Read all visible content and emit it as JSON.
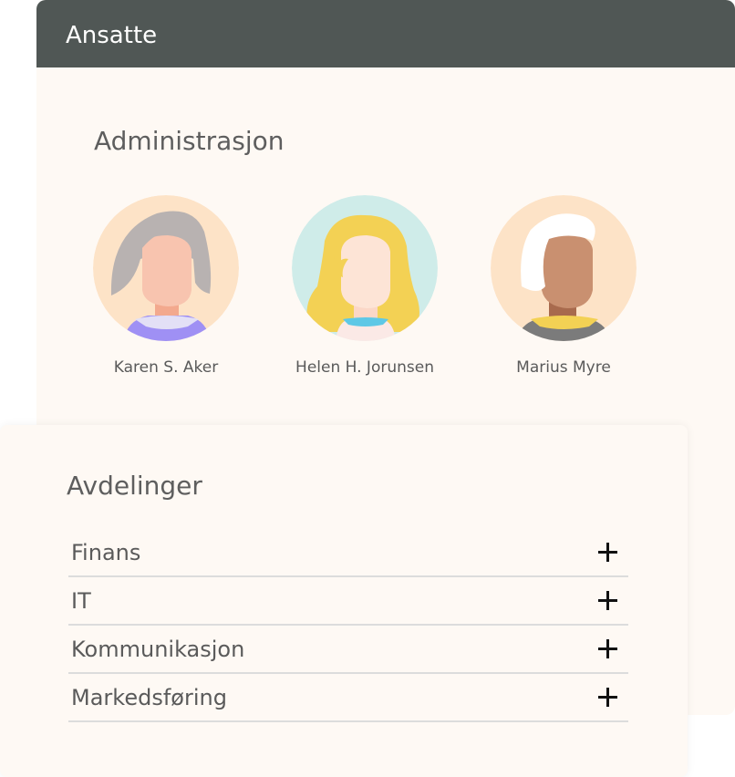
{
  "header": {
    "title": "Ansatte"
  },
  "admin": {
    "title": "Administrasjon",
    "people": [
      {
        "name": "Karen S. Aker",
        "avatar": "avatar-grey-hair"
      },
      {
        "name": "Helen H. Jorunsen",
        "avatar": "avatar-blonde-hair"
      },
      {
        "name": "Marius Myre",
        "avatar": "avatar-white-hair"
      }
    ]
  },
  "departments": {
    "title": "Avdelinger",
    "items": [
      {
        "label": "Finans"
      },
      {
        "label": "IT"
      },
      {
        "label": "Kommunikasjon"
      },
      {
        "label": "Markedsføring"
      }
    ]
  },
  "colors": {
    "header_bg": "#505755",
    "card_bg": "#fef9f4",
    "text": "#5a5a5a"
  }
}
